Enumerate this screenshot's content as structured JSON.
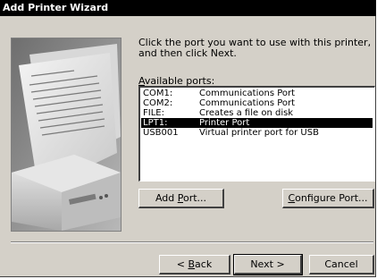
{
  "window": {
    "title": "Add Printer Wizard"
  },
  "instructions": "Click the port you want to use with this printer, and then click Next.",
  "ports": {
    "label": "Available ports:",
    "label_underline_char": "A",
    "label_rest": "vailable ports:",
    "items": [
      {
        "port": "COM1:",
        "description": "Communications Port",
        "selected": false
      },
      {
        "port": "COM2:",
        "description": "Communications Port",
        "selected": false
      },
      {
        "port": "FILE:",
        "description": "Creates a file on disk",
        "selected": false
      },
      {
        "port": "LPT1:",
        "description": "Printer Port",
        "selected": true
      },
      {
        "port": "USB001",
        "description": "Virtual printer port for USB",
        "selected": false
      }
    ]
  },
  "buttons": {
    "add_port": {
      "label": "Add Port...",
      "pre": "Add ",
      "u": "P",
      "post": "ort..."
    },
    "configure_port": {
      "label": "Configure Port...",
      "pre": "",
      "u": "C",
      "post": "onfigure Port..."
    },
    "back": {
      "label": "< Back",
      "pre": "< ",
      "u": "B",
      "post": "ack"
    },
    "next": {
      "label": "Next >"
    },
    "cancel": {
      "label": "Cancel"
    }
  },
  "colors": {
    "dialog_bg": "#d4d0c8",
    "titlebar_bg": "#000000",
    "selection_bg": "#000000",
    "selection_fg": "#ffffff"
  }
}
